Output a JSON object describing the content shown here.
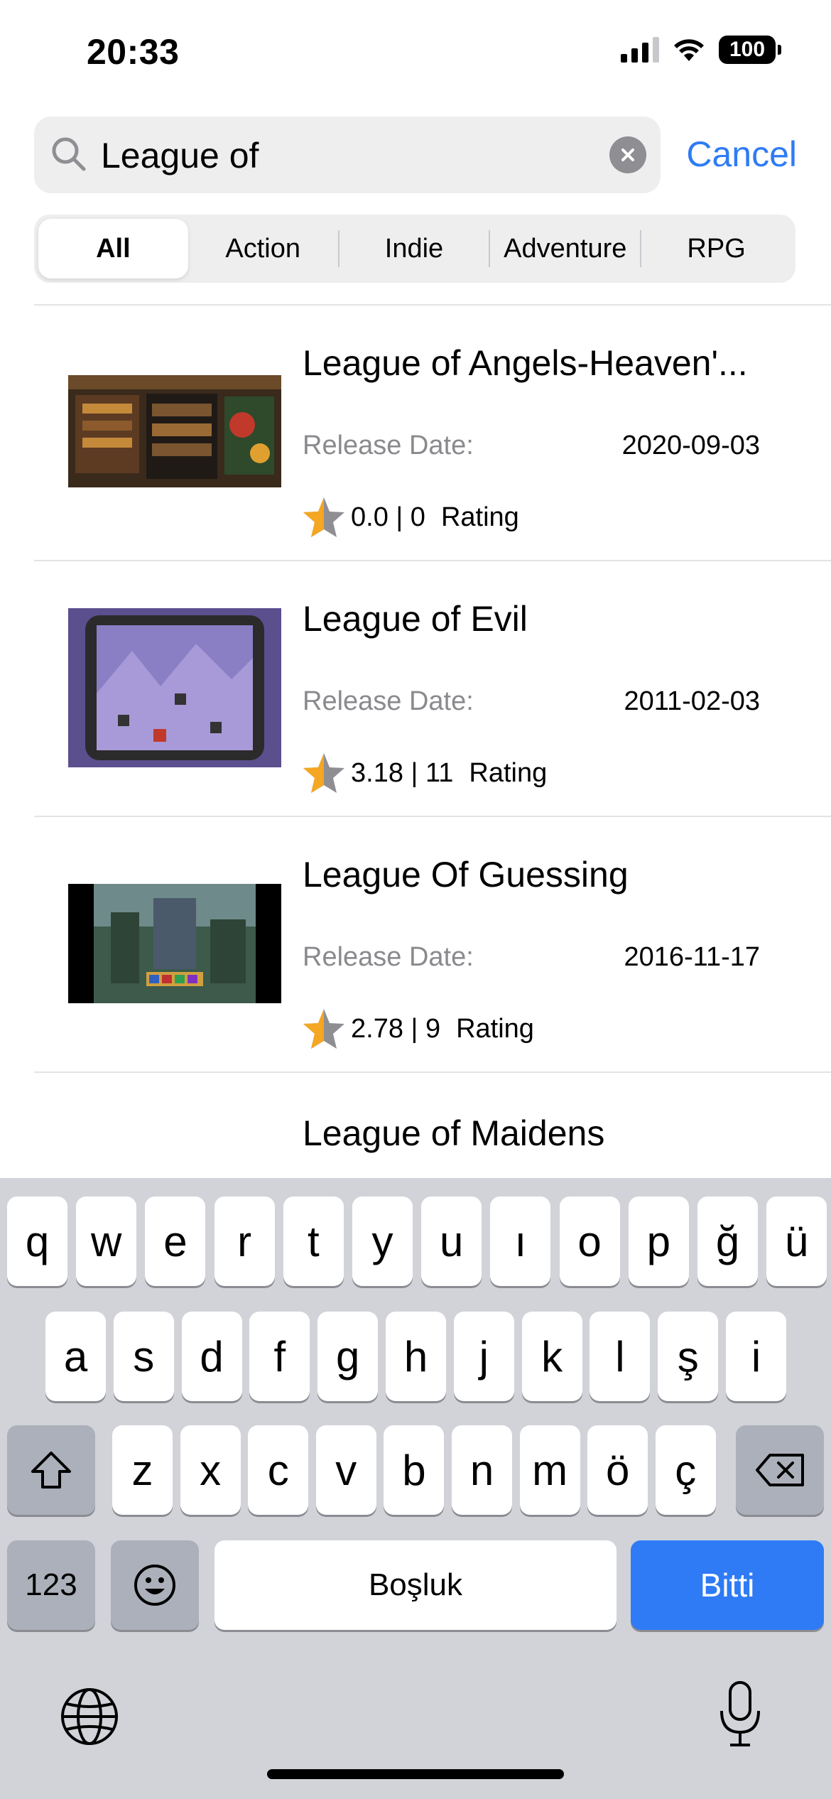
{
  "status_bar": {
    "time": "20:33",
    "battery": "100",
    "icons": [
      "cellular-signal-icon",
      "wifi-icon",
      "battery-icon"
    ]
  },
  "search": {
    "query": "League of",
    "cancel_label": "Cancel"
  },
  "filters": {
    "tabs": [
      {
        "label": "All",
        "selected": true
      },
      {
        "label": "Action",
        "selected": false
      },
      {
        "label": "Indie",
        "selected": false
      },
      {
        "label": "Adventure",
        "selected": false
      },
      {
        "label": "RPG",
        "selected": false
      }
    ]
  },
  "results": [
    {
      "title": "League of Angels-Heaven'...",
      "release_label": "Release Date:",
      "release_date": "2020-09-03",
      "rating_text": "0.0 | 0",
      "rating_label": "Rating"
    },
    {
      "title": "League of Evil",
      "release_label": "Release Date:",
      "release_date": "2011-02-03",
      "rating_text": "3.18 | 11",
      "rating_label": "Rating"
    },
    {
      "title": "League Of Guessing",
      "release_label": "Release Date:",
      "release_date": "2016-11-17",
      "rating_text": "2.78 | 9",
      "rating_label": "Rating"
    },
    {
      "title": "League of Maidens"
    }
  ],
  "keyboard": {
    "row1": [
      "q",
      "w",
      "e",
      "r",
      "t",
      "y",
      "u",
      "ı",
      "o",
      "p",
      "ğ",
      "ü"
    ],
    "row2": [
      "a",
      "s",
      "d",
      "f",
      "g",
      "h",
      "j",
      "k",
      "l",
      "ş",
      "i"
    ],
    "row3": [
      "z",
      "x",
      "c",
      "v",
      "b",
      "n",
      "m",
      "ö",
      "ç"
    ],
    "numbers_key": "123",
    "space_key": "Boşluk",
    "done_key": "Bitti"
  },
  "colors": {
    "accent": "#2f7bf5",
    "star": "#f5a623",
    "keyboard_bg": "#d1d3d9"
  }
}
